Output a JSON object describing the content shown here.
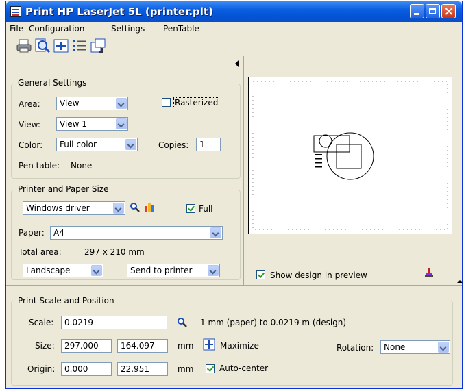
{
  "window": {
    "title": "Print  HP LaserJet 5L  (printer.plt)"
  },
  "menu": {
    "items": [
      "File",
      "Configuration",
      "Settings",
      "PenTable"
    ]
  },
  "toolbar": {
    "icons": [
      "printer-icon",
      "preview-magnifier-icon",
      "fit-icon",
      "list-icon",
      "page-setup-icon"
    ]
  },
  "general": {
    "title": "General Settings",
    "area_label": "Area:",
    "area_value": "View",
    "rasterized_label": "Rasterized",
    "rasterized_checked": false,
    "view_label": "View:",
    "view_value": "View 1",
    "color_label": "Color:",
    "color_value": "Full color",
    "copies_label": "Copies:",
    "copies_value": "1",
    "pentable_label": "Pen table:",
    "pentable_value": "None"
  },
  "printer": {
    "title": "Printer and Paper Size",
    "driver_value": "Windows driver",
    "full_label": "Full",
    "full_checked": true,
    "paper_label": "Paper:",
    "paper_value": "A4",
    "total_area_label": "Total area:",
    "total_area_value": "297 x 210 mm",
    "orientation_value": "Landscape",
    "send_value": "Send to printer"
  },
  "preview": {
    "show_design_label": "Show design in preview",
    "show_design_checked": true
  },
  "scale": {
    "title": "Print Scale and Position",
    "scale_label": "Scale:",
    "scale_value": "0.0219",
    "scale_desc": "1 mm (paper) to 0.0219 m (design)",
    "size_label": "Size:",
    "size_w": "297.000",
    "size_h": "164.097",
    "size_unit": "mm",
    "maximize_label": "Maximize",
    "rotation_label": "Rotation:",
    "rotation_value": "None",
    "origin_label": "Origin:",
    "origin_x": "0.000",
    "origin_y": "22.951",
    "origin_unit": "mm",
    "autocenter_label": "Auto-center",
    "autocenter_checked": true
  },
  "colors": {
    "title_bar": "#0a5fe0",
    "dialog_bg": "#ece9d8",
    "close_button": "#c8381a"
  }
}
